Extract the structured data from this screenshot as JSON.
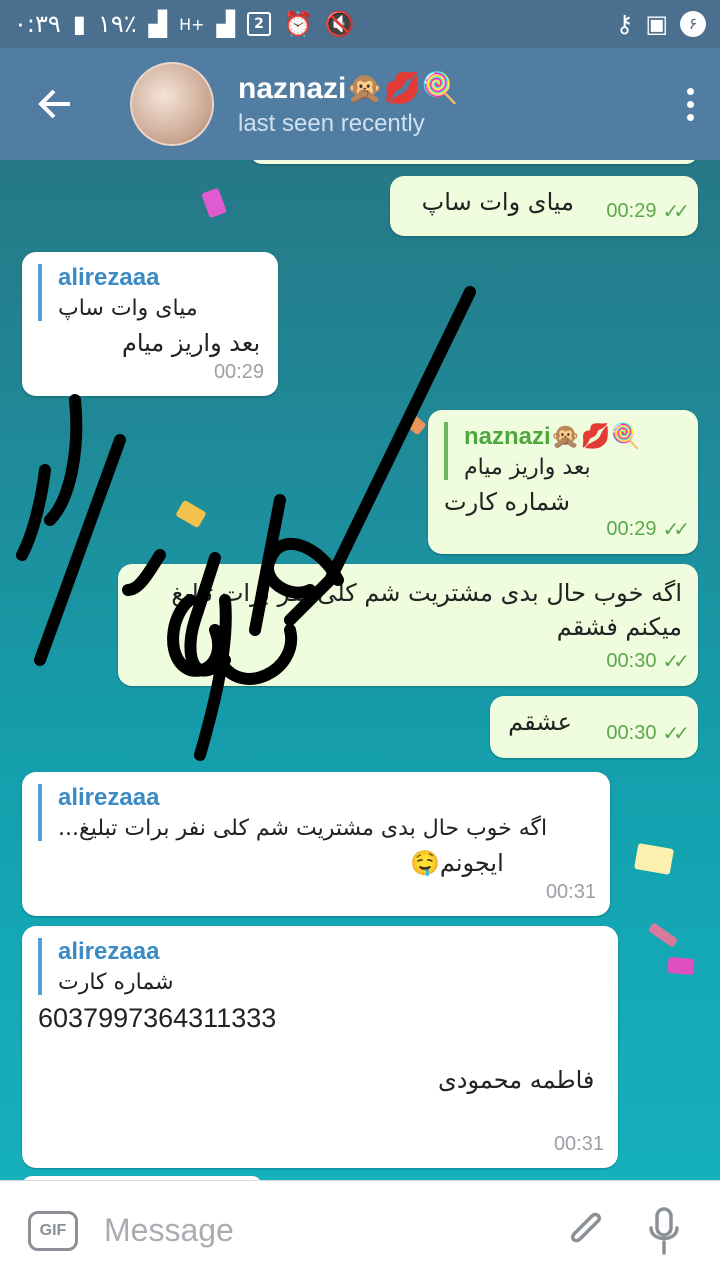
{
  "status_bar": {
    "time": "۰:۳۹",
    "battery": "۱۹٪",
    "sim_badge": "2",
    "notif_count": "۶"
  },
  "header": {
    "title": "naznazi🙊💋🍭",
    "subtitle": "last seen recently"
  },
  "messages": [
    {
      "text": "میای وات ساپ",
      "time": "00:29"
    },
    {
      "reply_name": "alirezaaa",
      "reply_text": "میای وات ساپ",
      "text": "بعد واریز میام",
      "time": "00:29"
    },
    {
      "reply_name": "naznazi🙊💋🍭",
      "reply_text": "بعد واریز میام",
      "text": "شماره کارت",
      "time": "00:29"
    },
    {
      "text": "اگه خوب حال بدی مشتریت شم کلی نفر برات تبلیغ میکنم فشقم",
      "time": "00:30"
    },
    {
      "text": "عشقم",
      "time": "00:30"
    },
    {
      "reply_name": "alirezaaa",
      "reply_text": "اگه خوب حال بدی مشتریت شم کلی نفر برات تبلیغ...",
      "text": "ایجونم🤤",
      "time": "00:31"
    },
    {
      "reply_name": "alirezaaa",
      "reply_text": "شماره کارت",
      "card_number": "6037997364311333",
      "card_owner": "فاطمه محمودی",
      "time": "00:31"
    }
  ],
  "input": {
    "gif_label": "GIF",
    "placeholder": "Message"
  }
}
